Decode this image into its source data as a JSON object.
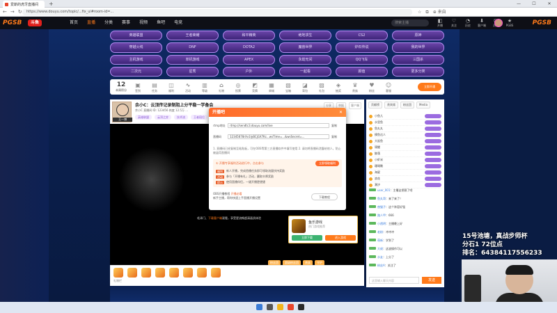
{
  "browser": {
    "tab_title": "爱斯的虎牙直播间",
    "url": "https://www.douyu.com/topic/...fix_ui#room-id=...",
    "window_controls": [
      "—",
      "☐",
      "✕"
    ],
    "address_right": "⊕ 来自"
  },
  "site": {
    "logo": "PGSB",
    "logo_right": "PGSB",
    "badge": "斗鱼",
    "nav": [
      "首页",
      "直播",
      "分类",
      "赛事",
      "视频",
      "鱼吧",
      "电竞"
    ],
    "search_placeholder": "搜索主播",
    "right_icons": [
      {
        "icon": "◧",
        "label": "开播"
      },
      {
        "icon": "♡",
        "label": "关注"
      },
      {
        "icon": "◔",
        "label": "历史"
      },
      {
        "icon": "⬇",
        "label": "客户端"
      },
      {
        "icon": "✉",
        "label": "消息"
      },
      {
        "icon": "★",
        "label": "PGBS"
      }
    ]
  },
  "tags": [
    "英雄联盟",
    "王者荣耀",
    "和平精英",
    "绝地求生",
    "CS2",
    "原神",
    "穿越火线",
    "DNF",
    "DOTA2",
    "魔兽世界",
    "炉石传说",
    "我的世界",
    "主机游戏",
    "单机游戏",
    "APEX",
    "永劫无间",
    "QQ飞车",
    "三国杀",
    "二次元",
    "星秀",
    "户外",
    "一起看",
    "颜值",
    "更多分类"
  ],
  "iconbar": {
    "level": "12",
    "level_label": "本周积分",
    "items": [
      "签到",
      "任务",
      "福利",
      "活动",
      "等级",
      "礼物",
      "投票",
      "竞猜",
      "商城",
      "宝箱",
      "背包",
      "礼包",
      "抽奖",
      "贵族",
      "粉丝",
      "客服"
    ],
    "cta": "立即开通"
  },
  "room": {
    "anchor_name": "王一博",
    "title": "余小C：云顶传记录制阻上分平稳一学备会",
    "meta": "余小C 直播间  ID: 123456  热度 12.5万  ...",
    "tags": [
      "英雄联盟",
      "云顶之弈",
      "技术流",
      "王者段位"
    ],
    "actions": [
      "分享",
      "举报",
      "客户端"
    ]
  },
  "player": {
    "overlay_text_a": "毛泽门、",
    "overlay_text_hl": "下载客户端",
    "overlay_text_b": "观看，享受更流畅超清画质体验"
  },
  "ad": {
    "title": "鱼乐游戏",
    "subtitle": "热门游戏推荐",
    "btn1": "立即下载",
    "btn2": "进入游戏"
  },
  "fanbar": [
    "粉丝团",
    "超级粉丝团",
    "贵族",
    "守护"
  ],
  "giftbar": {
    "label": "礼物栏"
  },
  "chat": {
    "tabs": [
      "贡献榜",
      "贵宾席",
      "粉丝团",
      "Media"
    ],
    "ranks": [
      "小鱼儿",
      "水里鱼",
      "鱼丸丸",
      "摸鱼达人",
      "大鲨鱼",
      "锦鲤",
      "鲸落",
      "小虾米",
      "珊瑚礁",
      "海星",
      "浪花",
      "潮汐"
    ],
    "messages": [
      {
        "name": "user_001",
        "text": "：主播这把稳了吧"
      },
      {
        "name": "鱼丸哥",
        "text": "：来了来了！"
      },
      {
        "name": "夜猫子",
        "text": "：这个阵容好强"
      },
      {
        "name": "路人甲",
        "text": "：666"
      },
      {
        "name": "小透明",
        "text": "：主播晚上好"
      },
      {
        "name": "老粉",
        "text": "：冲冲冲"
      },
      {
        "name": "萌新",
        "text": "：学到了"
      },
      {
        "name": "大佬",
        "text": "：这波操作可以"
      },
      {
        "name": "水友",
        "text": "：上分了"
      },
      {
        "name": "粉丝A",
        "text": "：关注了"
      }
    ],
    "input_placeholder": "这里输入聊天内容",
    "send": "发送"
  },
  "modal": {
    "title": "开播吧",
    "close": "✕",
    "row1_label": "rtmp地址",
    "row1_value": "rtmp://sendtc3.douyu.com/live",
    "row1_copy": "复制",
    "row2_label": "直播码",
    "row2_value": "12345678rXv1IyBCjGX7Kc...wsTime=...&wsSecret=...",
    "row2_copy": "复制",
    "hint": "1. 直播码已经复制至粘贴板，可在OBS等第三方直播软件中填写使用 2. 请勿将直播码泄露给他人，防止被盗用直播间",
    "box_head": "① 开播专享福利活动进行中，点击参与",
    "box_btn": "立即领取福利",
    "box_lines": [
      {
        "badge": "福利",
        "text": "新人开播，完成首播任务即可领取流量扶持奖励"
      },
      {
        "badge": "活动",
        "text": "参与「开播有礼」活动，赢取丰厚奖励"
      },
      {
        "badge": "提示",
        "text": "使用直播伴侣，一键开播更便捷"
      }
    ],
    "foot_line1": "OBS开播教程",
    "foot_hot": "开播必看",
    "foot_line2": "新手主播，帮你快速上手直播开播设置",
    "download": "下载教程"
  },
  "overlay": {
    "line1": "15号池塘，真战步师杯",
    "line2": "分石1 72位点",
    "line3": "排名：64384117556233"
  }
}
